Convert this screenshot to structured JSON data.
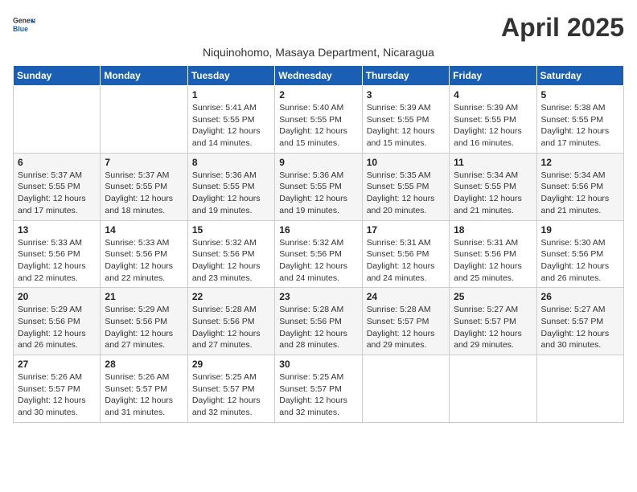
{
  "header": {
    "logo_general": "General",
    "logo_blue": "Blue",
    "month_title": "April 2025",
    "subtitle": "Niquinohomo, Masaya Department, Nicaragua"
  },
  "weekdays": [
    "Sunday",
    "Monday",
    "Tuesday",
    "Wednesday",
    "Thursday",
    "Friday",
    "Saturday"
  ],
  "weeks": [
    [
      {
        "day": "",
        "info": ""
      },
      {
        "day": "",
        "info": ""
      },
      {
        "day": "1",
        "info": "Sunrise: 5:41 AM\nSunset: 5:55 PM\nDaylight: 12 hours and 14 minutes."
      },
      {
        "day": "2",
        "info": "Sunrise: 5:40 AM\nSunset: 5:55 PM\nDaylight: 12 hours and 15 minutes."
      },
      {
        "day": "3",
        "info": "Sunrise: 5:39 AM\nSunset: 5:55 PM\nDaylight: 12 hours and 15 minutes."
      },
      {
        "day": "4",
        "info": "Sunrise: 5:39 AM\nSunset: 5:55 PM\nDaylight: 12 hours and 16 minutes."
      },
      {
        "day": "5",
        "info": "Sunrise: 5:38 AM\nSunset: 5:55 PM\nDaylight: 12 hours and 17 minutes."
      }
    ],
    [
      {
        "day": "6",
        "info": "Sunrise: 5:37 AM\nSunset: 5:55 PM\nDaylight: 12 hours and 17 minutes."
      },
      {
        "day": "7",
        "info": "Sunrise: 5:37 AM\nSunset: 5:55 PM\nDaylight: 12 hours and 18 minutes."
      },
      {
        "day": "8",
        "info": "Sunrise: 5:36 AM\nSunset: 5:55 PM\nDaylight: 12 hours and 19 minutes."
      },
      {
        "day": "9",
        "info": "Sunrise: 5:36 AM\nSunset: 5:55 PM\nDaylight: 12 hours and 19 minutes."
      },
      {
        "day": "10",
        "info": "Sunrise: 5:35 AM\nSunset: 5:55 PM\nDaylight: 12 hours and 20 minutes."
      },
      {
        "day": "11",
        "info": "Sunrise: 5:34 AM\nSunset: 5:55 PM\nDaylight: 12 hours and 21 minutes."
      },
      {
        "day": "12",
        "info": "Sunrise: 5:34 AM\nSunset: 5:56 PM\nDaylight: 12 hours and 21 minutes."
      }
    ],
    [
      {
        "day": "13",
        "info": "Sunrise: 5:33 AM\nSunset: 5:56 PM\nDaylight: 12 hours and 22 minutes."
      },
      {
        "day": "14",
        "info": "Sunrise: 5:33 AM\nSunset: 5:56 PM\nDaylight: 12 hours and 22 minutes."
      },
      {
        "day": "15",
        "info": "Sunrise: 5:32 AM\nSunset: 5:56 PM\nDaylight: 12 hours and 23 minutes."
      },
      {
        "day": "16",
        "info": "Sunrise: 5:32 AM\nSunset: 5:56 PM\nDaylight: 12 hours and 24 minutes."
      },
      {
        "day": "17",
        "info": "Sunrise: 5:31 AM\nSunset: 5:56 PM\nDaylight: 12 hours and 24 minutes."
      },
      {
        "day": "18",
        "info": "Sunrise: 5:31 AM\nSunset: 5:56 PM\nDaylight: 12 hours and 25 minutes."
      },
      {
        "day": "19",
        "info": "Sunrise: 5:30 AM\nSunset: 5:56 PM\nDaylight: 12 hours and 26 minutes."
      }
    ],
    [
      {
        "day": "20",
        "info": "Sunrise: 5:29 AM\nSunset: 5:56 PM\nDaylight: 12 hours and 26 minutes."
      },
      {
        "day": "21",
        "info": "Sunrise: 5:29 AM\nSunset: 5:56 PM\nDaylight: 12 hours and 27 minutes."
      },
      {
        "day": "22",
        "info": "Sunrise: 5:28 AM\nSunset: 5:56 PM\nDaylight: 12 hours and 27 minutes."
      },
      {
        "day": "23",
        "info": "Sunrise: 5:28 AM\nSunset: 5:56 PM\nDaylight: 12 hours and 28 minutes."
      },
      {
        "day": "24",
        "info": "Sunrise: 5:28 AM\nSunset: 5:57 PM\nDaylight: 12 hours and 29 minutes."
      },
      {
        "day": "25",
        "info": "Sunrise: 5:27 AM\nSunset: 5:57 PM\nDaylight: 12 hours and 29 minutes."
      },
      {
        "day": "26",
        "info": "Sunrise: 5:27 AM\nSunset: 5:57 PM\nDaylight: 12 hours and 30 minutes."
      }
    ],
    [
      {
        "day": "27",
        "info": "Sunrise: 5:26 AM\nSunset: 5:57 PM\nDaylight: 12 hours and 30 minutes."
      },
      {
        "day": "28",
        "info": "Sunrise: 5:26 AM\nSunset: 5:57 PM\nDaylight: 12 hours and 31 minutes."
      },
      {
        "day": "29",
        "info": "Sunrise: 5:25 AM\nSunset: 5:57 PM\nDaylight: 12 hours and 32 minutes."
      },
      {
        "day": "30",
        "info": "Sunrise: 5:25 AM\nSunset: 5:57 PM\nDaylight: 12 hours and 32 minutes."
      },
      {
        "day": "",
        "info": ""
      },
      {
        "day": "",
        "info": ""
      },
      {
        "day": "",
        "info": ""
      }
    ]
  ]
}
